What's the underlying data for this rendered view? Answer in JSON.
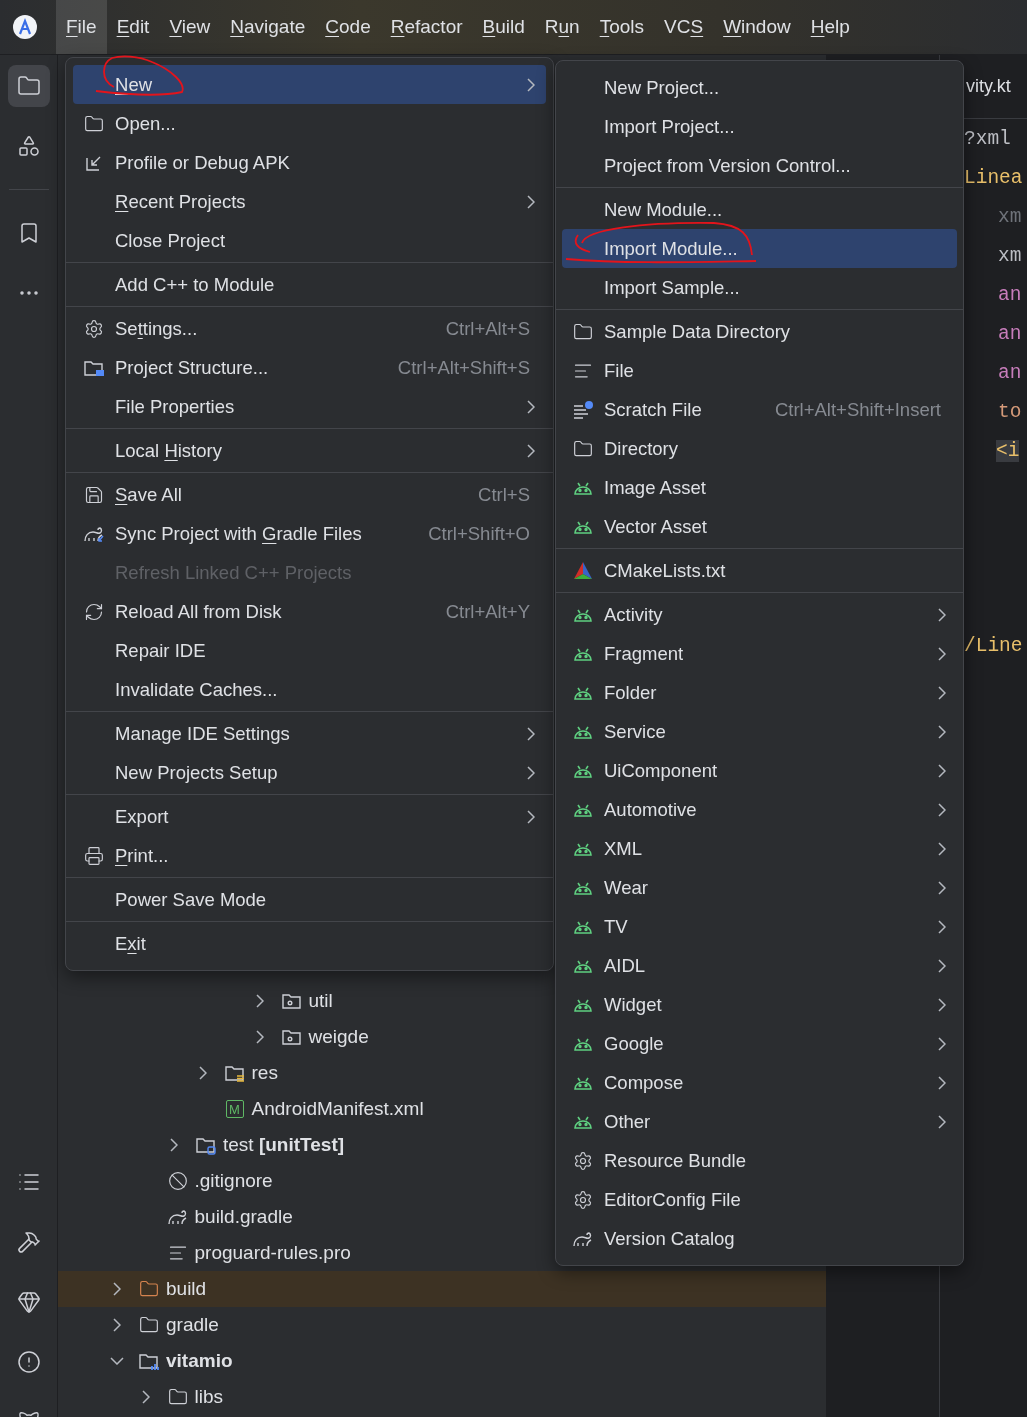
{
  "menubar": {
    "items": [
      {
        "label": {
          "key": "F",
          "post": "ile"
        },
        "selected": true
      },
      {
        "label": {
          "key": "E",
          "post": "dit"
        },
        "selected": false
      },
      {
        "label": {
          "key": "V",
          "post": "iew"
        },
        "selected": false
      },
      {
        "label": {
          "key": "N",
          "post": "avigate"
        },
        "selected": false
      },
      {
        "label": {
          "key": "C",
          "post": "ode"
        },
        "selected": false
      },
      {
        "label": {
          "key": "R",
          "post": "efactor"
        },
        "selected": false
      },
      {
        "label": {
          "key": "B",
          "post": "uild"
        },
        "selected": false
      },
      {
        "label": {
          "pre": "R",
          "key": "u",
          "post": "n"
        },
        "selected": false
      },
      {
        "label": {
          "key": "T",
          "post": "ools"
        },
        "selected": false
      },
      {
        "label": {
          "pre": "VC",
          "key": "S"
        },
        "selected": false
      },
      {
        "label": {
          "key": "W",
          "post": "indow"
        },
        "selected": false
      },
      {
        "label": {
          "key": "H",
          "post": "elp"
        },
        "selected": false
      }
    ]
  },
  "toolstrip": {
    "top": [
      [
        {
          "kind": "folder",
          "selected": true
        },
        {
          "kind": "shapes",
          "selected": false
        }
      ],
      [
        {
          "kind": "bookmark",
          "selected": false
        },
        {
          "kind": "more",
          "selected": false
        }
      ]
    ],
    "bottom": [
      {
        "kind": "list"
      },
      {
        "kind": "hammer"
      },
      {
        "kind": "diamond"
      },
      {
        "kind": "alert"
      },
      {
        "kind": "cat"
      }
    ]
  },
  "editor": {
    "tab": "vity.kt",
    "lines": [
      {
        "kind": "prolog",
        "text": "?xml"
      },
      {
        "kind": "tag",
        "text": "Linea"
      },
      {
        "kind": "ns-dim",
        "text": "xm"
      },
      {
        "kind": "ns",
        "text": "xm"
      },
      {
        "kind": "attr",
        "text": "an"
      },
      {
        "kind": "attr",
        "text": "an"
      },
      {
        "kind": "attr",
        "text": "an"
      },
      {
        "kind": "tools-attr",
        "text": "to"
      },
      {
        "kind": "child-tag",
        "text": "<i"
      },
      {
        "kind": "blank"
      },
      {
        "kind": "blank"
      },
      {
        "kind": "blank"
      },
      {
        "kind": "blank"
      },
      {
        "kind": "close-tag",
        "text": "/Line"
      }
    ]
  },
  "project_tree": {
    "nodes": [
      {
        "children": [
          {
            "children": [
              {
                "children": [
                  {
                    "children": [
                      {
                        "children": [
                          {
                            "kind": "package",
                            "label": "util",
                            "expanded": false,
                            "bold": false,
                            "highlighted": false
                          },
                          {
                            "kind": "package",
                            "label": "weigde",
                            "expanded": false,
                            "bold": false,
                            "highlighted": false
                          }
                        ]
                      }
                    ]
                  },
                  {
                    "kind": "res",
                    "label": "res",
                    "expanded": false,
                    "bold": false,
                    "highlighted": false
                  },
                  {
                    "kind": "manifest",
                    "label": "AndroidManifest.xml",
                    "badge": "M",
                    "bold": false,
                    "highlighted": false
                  }
                ]
              },
              {
                "kind": "test",
                "label": "test **[unitTest]**",
                "expanded": false,
                "bold": false,
                "highlighted": false
              }
            ]
          },
          {
            "kind": "ignore",
            "label": ".gitignore",
            "bold": false,
            "highlighted": false
          },
          {
            "kind": "gradle",
            "label": "build.gradle",
            "bold": false,
            "highlighted": false
          },
          {
            "kind": "text",
            "label": "proguard-rules.pro",
            "bold": false,
            "highlighted": false
          }
        ]
      },
      {
        "kind": "excluded",
        "label": "build",
        "expanded": false,
        "bold": false,
        "highlighted": true
      },
      {
        "kind": "folder",
        "label": "gradle",
        "expanded": false,
        "bold": false,
        "highlighted": false
      },
      {
        "kind": "module",
        "label": "vitamio",
        "expanded": true,
        "bold": true,
        "highlighted": false,
        "children": [
          {
            "kind": "folder",
            "label": "libs",
            "expanded": false,
            "bold": false,
            "highlighted": false
          }
        ]
      }
    ]
  },
  "file_menu": {
    "groups": [
      [
        {
          "kind": "plain",
          "label": {
            "key": "N",
            "post": "ew"
          },
          "submenu": true,
          "selected": true,
          "disabled": false
        },
        {
          "kind": "folder",
          "label": "Open...",
          "submenu": false,
          "selected": false,
          "disabled": false
        },
        {
          "kind": "apk",
          "label": "Profile or Debug APK",
          "submenu": false,
          "selected": false,
          "disabled": false
        },
        {
          "kind": "plain",
          "label": {
            "key": "R",
            "post": "ecent Projects"
          },
          "submenu": true,
          "selected": false,
          "disabled": false
        },
        {
          "kind": "plain",
          "label": "Close Project",
          "submenu": false,
          "selected": false,
          "disabled": false
        }
      ],
      [
        {
          "kind": "plain",
          "label": "Add C++ to Module",
          "submenu": false,
          "selected": false,
          "disabled": false
        }
      ],
      [
        {
          "kind": "gear",
          "label": {
            "pre": "Se",
            "key": "t",
            "post": "tings..."
          },
          "shortcut": "Ctrl+Alt+S",
          "submenu": false,
          "selected": false,
          "disabled": false
        },
        {
          "kind": "structure",
          "label": "Project Structure...",
          "shortcut": "Ctrl+Alt+Shift+S",
          "submenu": false,
          "selected": false,
          "disabled": false
        },
        {
          "kind": "plain",
          "label": "File Properties",
          "submenu": true,
          "selected": false,
          "disabled": false
        }
      ],
      [
        {
          "kind": "plain",
          "label": {
            "pre": "Local ",
            "key": "H",
            "post": "istory"
          },
          "submenu": true,
          "selected": false,
          "disabled": false
        }
      ],
      [
        {
          "kind": "save",
          "label": {
            "key": "S",
            "post": "ave All"
          },
          "shortcut": "Ctrl+S",
          "submenu": false,
          "selected": false,
          "disabled": false
        },
        {
          "kind": "sync",
          "label": {
            "pre": "Sync Project with ",
            "key": "G",
            "post": "radle Files"
          },
          "shortcut": "Ctrl+Shift+O",
          "submenu": false,
          "selected": false,
          "disabled": false
        },
        {
          "kind": "plain",
          "label": "Refresh Linked C++ Projects",
          "submenu": false,
          "selected": false,
          "disabled": true
        },
        {
          "kind": "reload",
          "label": "Reload All from Disk",
          "shortcut": "Ctrl+Alt+Y",
          "submenu": false,
          "selected": false,
          "disabled": false
        },
        {
          "kind": "plain",
          "label": "Repair IDE",
          "submenu": false,
          "selected": false,
          "disabled": false
        },
        {
          "kind": "plain",
          "label": "Invalidate Caches...",
          "submenu": false,
          "selected": false,
          "disabled": false
        }
      ],
      [
        {
          "kind": "plain",
          "label": "Manage IDE Settings",
          "submenu": true,
          "selected": false,
          "disabled": false
        },
        {
          "kind": "plain",
          "label": "New Projects Setup",
          "submenu": true,
          "selected": false,
          "disabled": false
        }
      ],
      [
        {
          "kind": "plain",
          "label": "Export",
          "submenu": true,
          "selected": false,
          "disabled": false
        },
        {
          "kind": "print",
          "label": {
            "key": "P",
            "post": "rint..."
          },
          "submenu": false,
          "selected": false,
          "disabled": false
        }
      ],
      [
        {
          "kind": "plain",
          "label": "Power Save Mode",
          "submenu": false,
          "selected": false,
          "disabled": false
        }
      ],
      [
        {
          "kind": "plain",
          "label": {
            "pre": "E",
            "key": "x",
            "post": "it"
          },
          "submenu": false,
          "selected": false,
          "disabled": false
        }
      ]
    ]
  },
  "new_submenu": {
    "groups": [
      [
        {
          "kind": "plain",
          "label": "New Project...",
          "submenu": false,
          "selected": false,
          "disabled": false
        },
        {
          "kind": "plain",
          "label": "Import Project...",
          "submenu": false,
          "selected": false,
          "disabled": false
        },
        {
          "kind": "plain",
          "label": "Project from Version Control...",
          "submenu": false,
          "selected": false,
          "disabled": false
        }
      ],
      [
        {
          "kind": "plain",
          "label": "New Module...",
          "submenu": false,
          "selected": false,
          "disabled": false
        },
        {
          "kind": "plain",
          "label": "Import Module...",
          "submenu": false,
          "selected": true,
          "disabled": false
        },
        {
          "kind": "plain",
          "label": "Import Sample...",
          "submenu": false,
          "selected": false,
          "disabled": false
        }
      ],
      [
        {
          "kind": "folder",
          "label": "Sample Data Directory",
          "submenu": false,
          "selected": false,
          "disabled": false
        },
        {
          "kind": "lines",
          "label": "File",
          "submenu": false,
          "selected": false,
          "disabled": false
        },
        {
          "kind": "scratch",
          "label": "Scratch File",
          "shortcut": "Ctrl+Alt+Shift+Insert",
          "submenu": false,
          "selected": false,
          "disabled": false
        },
        {
          "kind": "folder",
          "label": "Directory",
          "submenu": false,
          "selected": false,
          "disabled": false
        },
        {
          "kind": "android",
          "label": "Image Asset",
          "submenu": false,
          "selected": false,
          "disabled": false
        },
        {
          "kind": "android",
          "label": "Vector Asset",
          "submenu": false,
          "selected": false,
          "disabled": false
        }
      ],
      [
        {
          "kind": "cmake",
          "label": "CMakeLists.txt",
          "submenu": false,
          "selected": false,
          "disabled": false
        }
      ],
      [
        {
          "kind": "android",
          "label": "Activity",
          "submenu": true,
          "selected": false,
          "disabled": false
        },
        {
          "kind": "android",
          "label": "Fragment",
          "submenu": true,
          "selected": false,
          "disabled": false
        },
        {
          "kind": "android",
          "label": "Folder",
          "submenu": true,
          "selected": false,
          "disabled": false
        },
        {
          "kind": "android",
          "label": "Service",
          "submenu": true,
          "selected": false,
          "disabled": false
        },
        {
          "kind": "android",
          "label": "UiComponent",
          "submenu": true,
          "selected": false,
          "disabled": false
        },
        {
          "kind": "android",
          "label": "Automotive",
          "submenu": true,
          "selected": false,
          "disabled": false
        },
        {
          "kind": "android",
          "label": "XML",
          "submenu": true,
          "selected": false,
          "disabled": false
        },
        {
          "kind": "android",
          "label": "Wear",
          "submenu": true,
          "selected": false,
          "disabled": false
        },
        {
          "kind": "android",
          "label": "TV",
          "submenu": true,
          "selected": false,
          "disabled": false
        },
        {
          "kind": "android",
          "label": "AIDL",
          "submenu": true,
          "selected": false,
          "disabled": false
        },
        {
          "kind": "android",
          "label": "Widget",
          "submenu": true,
          "selected": false,
          "disabled": false
        },
        {
          "kind": "android",
          "label": "Google",
          "submenu": true,
          "selected": false,
          "disabled": false
        },
        {
          "kind": "android",
          "label": "Compose",
          "submenu": true,
          "selected": false,
          "disabled": false
        },
        {
          "kind": "android",
          "label": "Other",
          "submenu": true,
          "selected": false,
          "disabled": false
        },
        {
          "kind": "gear",
          "label": "Resource Bundle",
          "submenu": false,
          "selected": false,
          "disabled": false
        },
        {
          "kind": "gear",
          "label": "EditorConfig File",
          "submenu": false,
          "selected": false,
          "disabled": false
        },
        {
          "kind": "gradle",
          "label": "Version Catalog",
          "submenu": false,
          "selected": false,
          "disabled": false
        }
      ]
    ]
  }
}
